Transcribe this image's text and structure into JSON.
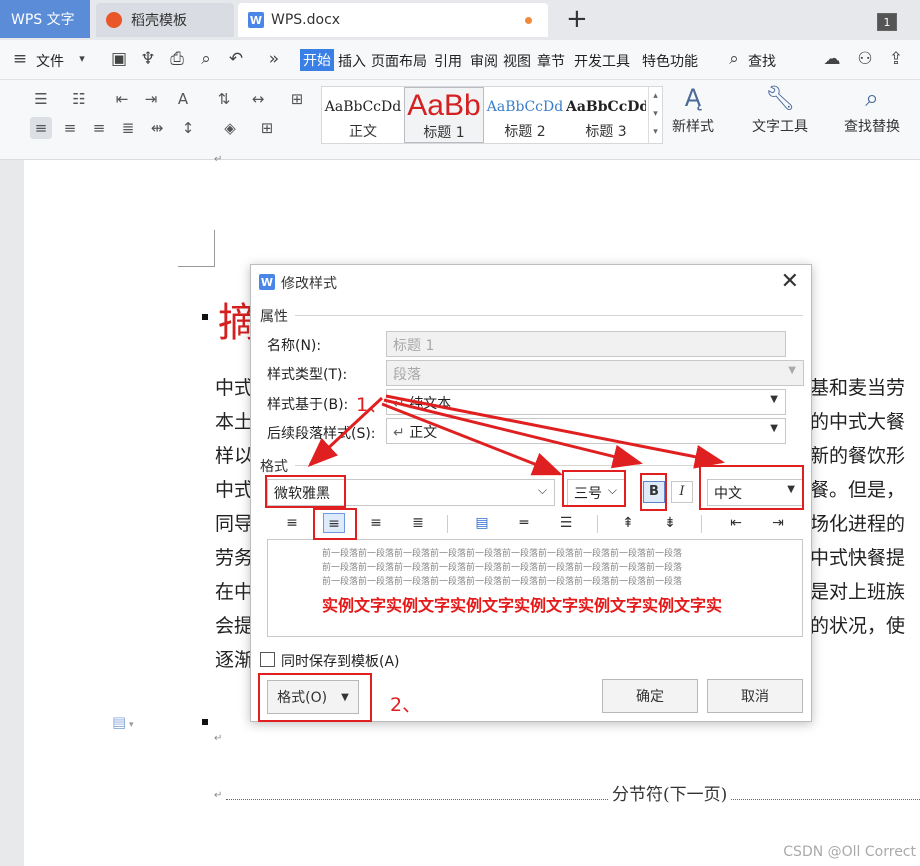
{
  "titlebar": {
    "tab_wps": "WPS 文字",
    "tab_template": "稻壳模板",
    "tab_doc": "WPS.docx",
    "new_tab": "+",
    "window_count": "1"
  },
  "menubar": {
    "file": "文件",
    "items": [
      "开始",
      "插入",
      "页面布局",
      "引用",
      "审阅",
      "视图",
      "章节",
      "开发工具",
      "特色功能"
    ],
    "search": "查找"
  },
  "ribbon": {
    "styles": [
      {
        "preview": "AaBbCcDd",
        "name": "正文"
      },
      {
        "preview": "AaBb",
        "name": "标题 1"
      },
      {
        "preview": "AaBbCcDd",
        "name": "标题 2"
      },
      {
        "preview": "AaBbCcDd",
        "name": "标题 3"
      }
    ],
    "new_style": "新样式",
    "text_tools": "文字工具",
    "find_replace": "查找替换"
  },
  "document": {
    "heading_char": "摘",
    "lines_left": [
      "中式",
      "本土",
      "样以",
      "中式",
      "同导",
      "劳务",
      "在中",
      "会提",
      "逐渐"
    ],
    "lines_right": [
      "基和麦当劳",
      "的中式大餐",
      "新的餐饮形",
      "餐。但是，",
      "场化进程的",
      "中式快餐提",
      "是对上班族",
      "的状况，使"
    ],
    "section_break": "分节符(下一页)"
  },
  "dialog": {
    "title": "修改样式",
    "properties_section": "属性",
    "name_label": "名称(N):",
    "name_value": "标题 1",
    "style_type_label": "样式类型(T):",
    "style_type_value": "段落",
    "based_on_label": "样式基于(B):",
    "based_on_value": "纯文本",
    "next_para_label": "后续段落样式(S):",
    "next_para_value": "正文",
    "format_section": "格式",
    "font_value": "微软雅黑",
    "size_value": "三号",
    "bold": "B",
    "italic": "I",
    "script_value": "中文",
    "preview_prev": "前一段落前一段落前一段落前一段落前一段落前一段落前一段落前一段落前一段落前一段落",
    "preview_sample": "实例文字实例文字实例文字实例文字实例文字实例文字实",
    "save_to_template": "同时保存到模板(A)",
    "format_button": "格式(O)",
    "ok": "确定",
    "cancel": "取消"
  },
  "annotations": {
    "label1": "1、",
    "label2": "2、",
    "color": "#e02020"
  },
  "watermark": "CSDN @Oll Correct"
}
